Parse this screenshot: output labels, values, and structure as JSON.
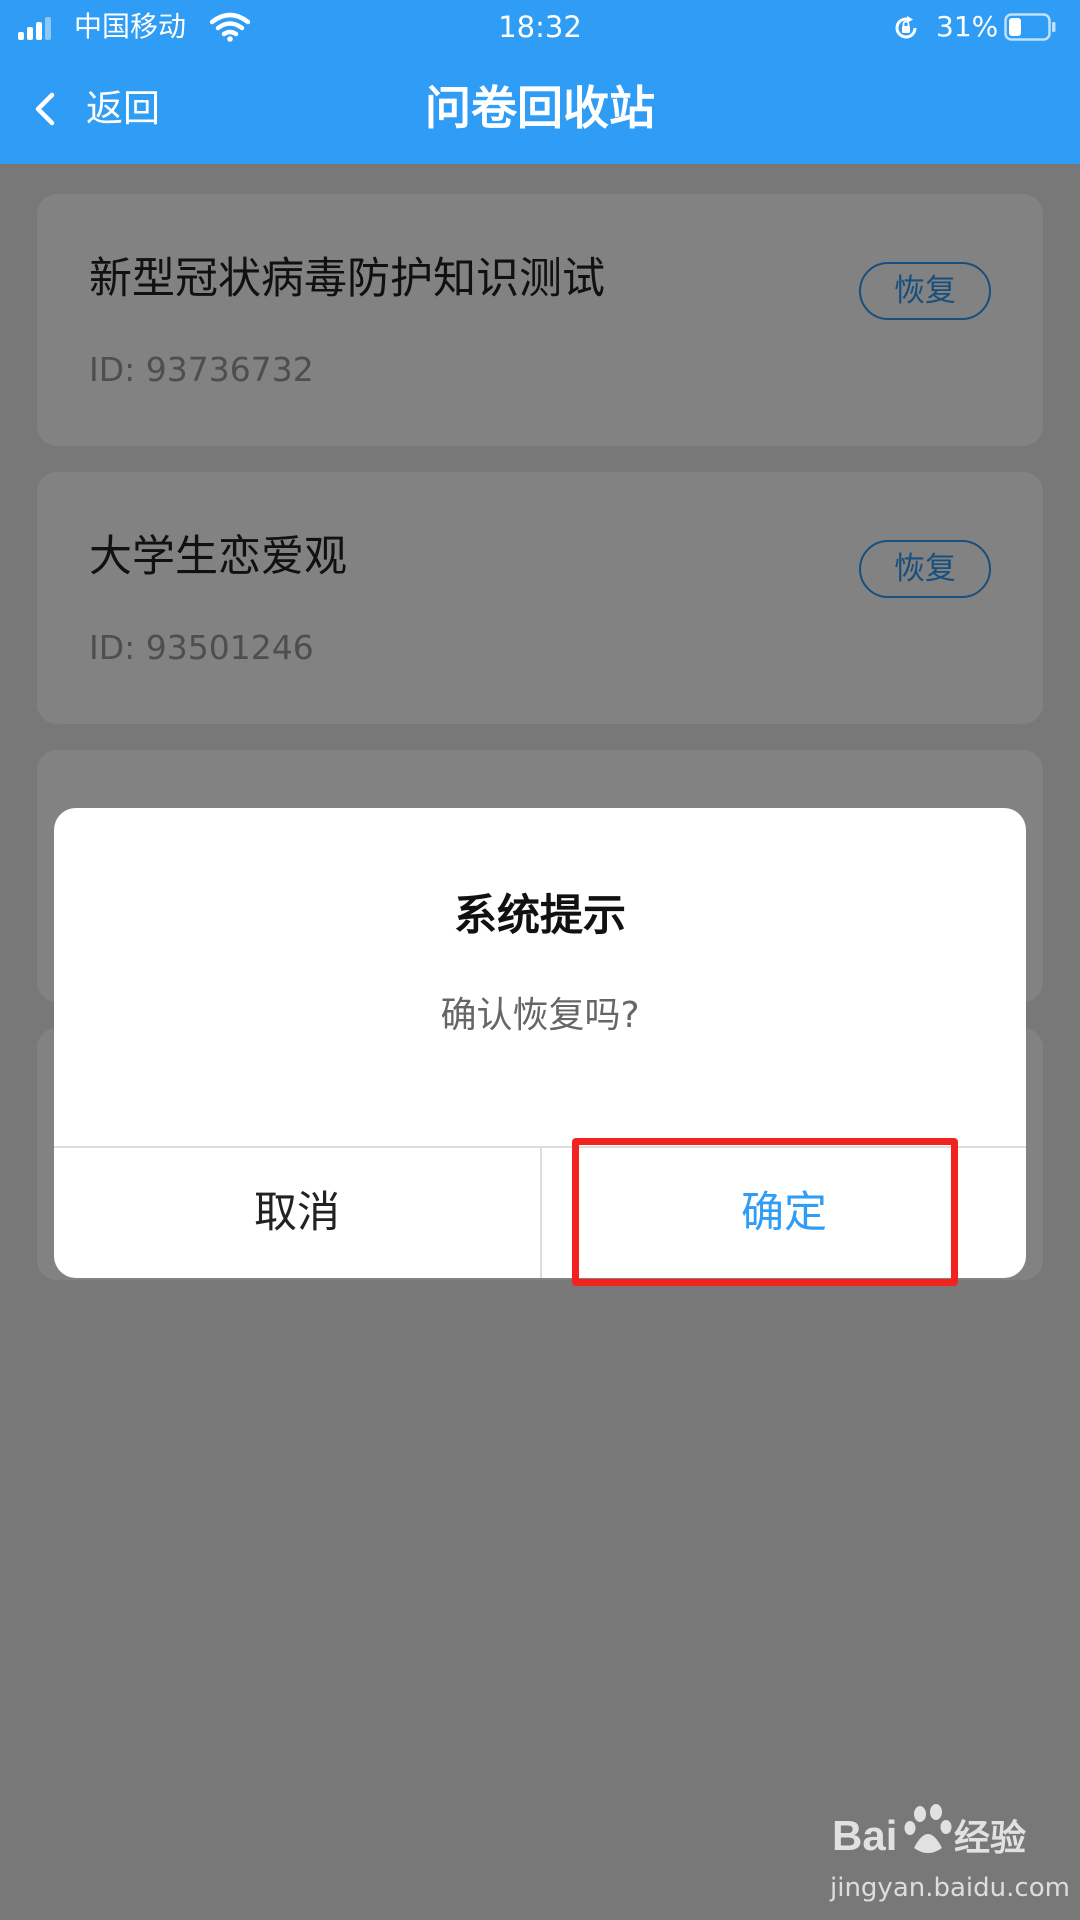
{
  "status_bar": {
    "carrier": "中国移动",
    "time": "18:32",
    "battery_percent": "31%"
  },
  "nav": {
    "back_label": "返回",
    "title": "问卷回收站"
  },
  "surveys": [
    {
      "title": "新型冠状病毒防护知识测试",
      "id": "ID: 93736732",
      "restore_label": "恢复"
    },
    {
      "title": "大学生恋爱观",
      "id": "ID: 93501246",
      "restore_label": "恢复"
    }
  ],
  "dialog": {
    "title": "系统提示",
    "message": "确认恢复吗?",
    "cancel_label": "取消",
    "confirm_label": "确定"
  },
  "watermark": {
    "logo_text": "Bai经验",
    "url": "jingyan.baidu.com"
  },
  "colors": {
    "accent": "#2f9cf5",
    "highlight": "#f2221e"
  }
}
